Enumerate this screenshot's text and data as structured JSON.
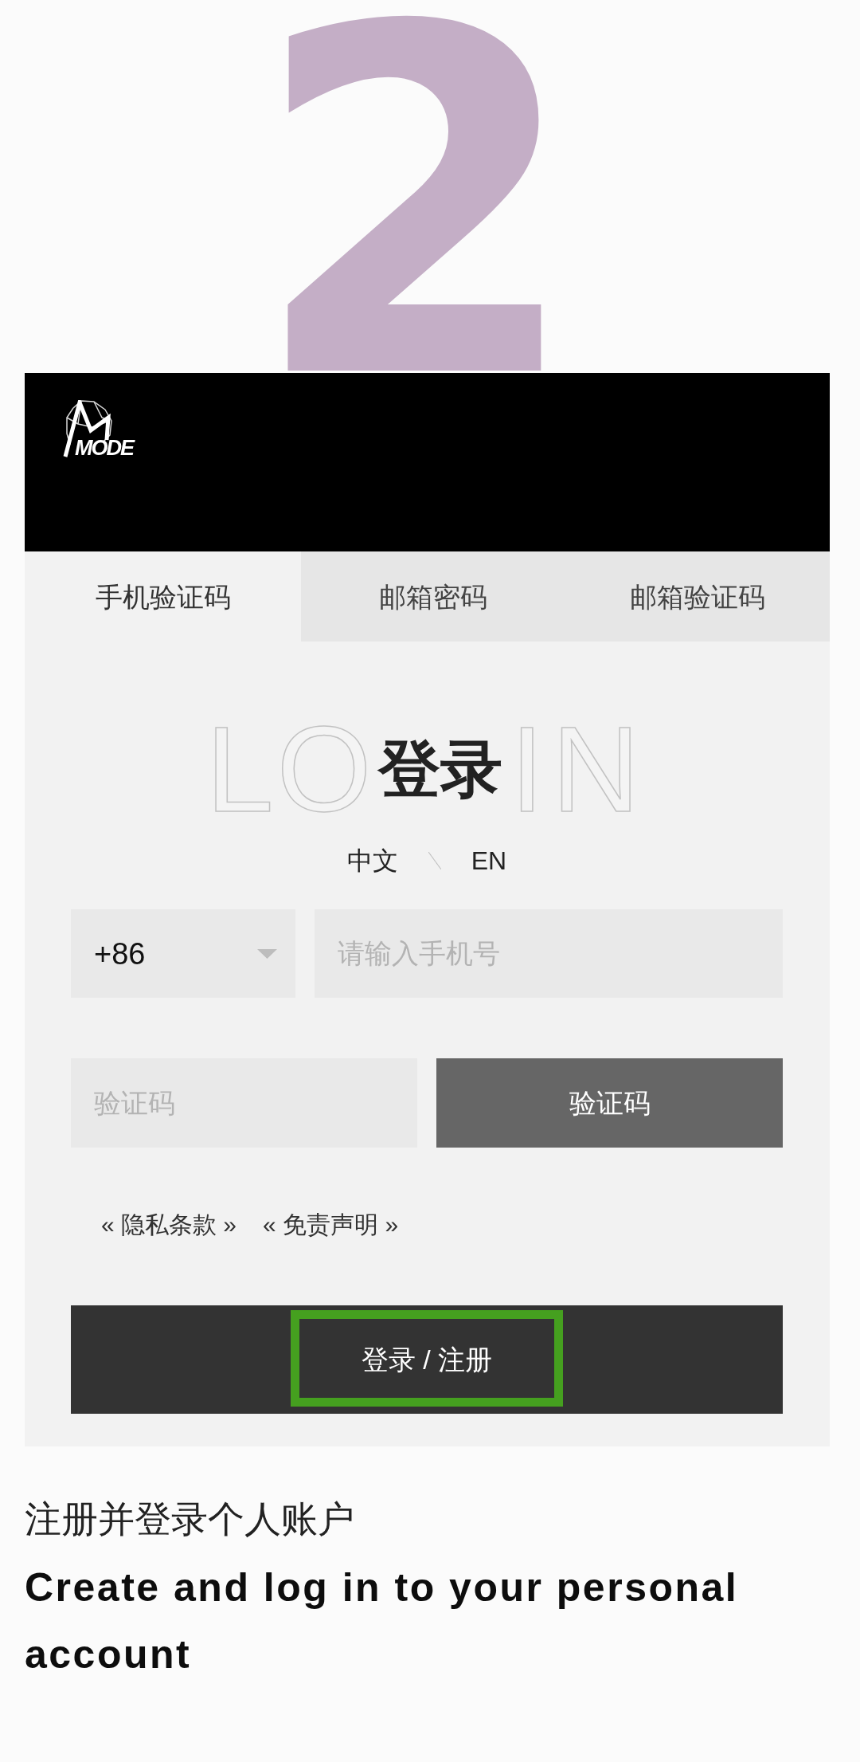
{
  "step_number": "2",
  "header": {
    "logo_text": "MODE"
  },
  "tabs": [
    {
      "label": "手机验证码",
      "selected": true
    },
    {
      "label": "邮箱密码",
      "selected": false
    },
    {
      "label": "邮箱验证码",
      "selected": false
    }
  ],
  "login": {
    "watermark_left": "LO",
    "watermark_right": "IN",
    "title": "登录",
    "languages": [
      "中文",
      "EN"
    ],
    "country_code": {
      "value": "+86"
    },
    "phone": {
      "placeholder": "请输入手机号"
    },
    "code": {
      "placeholder": "验证码"
    },
    "code_button": "验证码",
    "links": [
      "« 隐私条款 »",
      "« 免责声明 »"
    ],
    "submit": {
      "label": "登录 / 注册",
      "highlighted": true
    }
  },
  "caption": {
    "chinese": "注册并登录个人账户",
    "english": "Create and log in to your personal account"
  }
}
